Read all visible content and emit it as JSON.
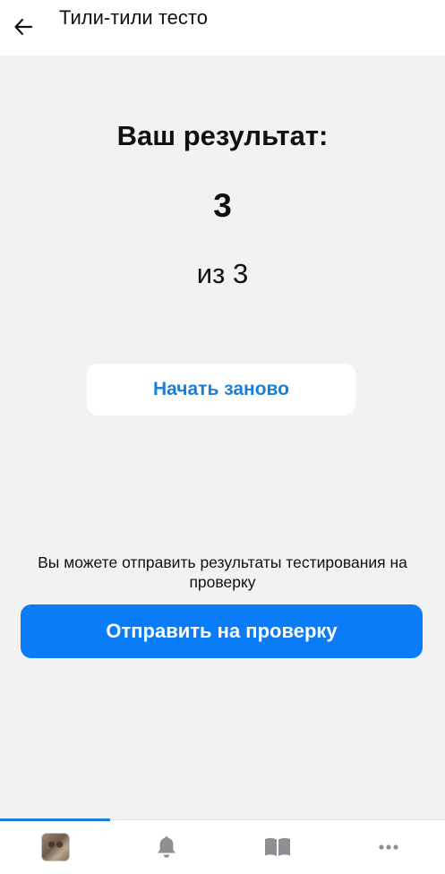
{
  "header": {
    "title": "Тили-тили тесто"
  },
  "result": {
    "title": "Ваш результат:",
    "score": "3",
    "total_label": "из 3"
  },
  "actions": {
    "restart_label": "Начать заново",
    "info_text": "Вы можете отправить результаты тестирования на проверку",
    "submit_label": "Отправить на проверку"
  },
  "tabbar": {
    "tabs": [
      {
        "icon": "avatar-icon",
        "active": true
      },
      {
        "icon": "bell-icon",
        "active": false
      },
      {
        "icon": "book-icon",
        "active": false
      },
      {
        "icon": "more-icon",
        "active": false
      }
    ]
  },
  "colors": {
    "accent": "#0a7cf8",
    "link": "#1a7fd9",
    "background": "#f2f2f2",
    "icon": "#8e8e93"
  }
}
